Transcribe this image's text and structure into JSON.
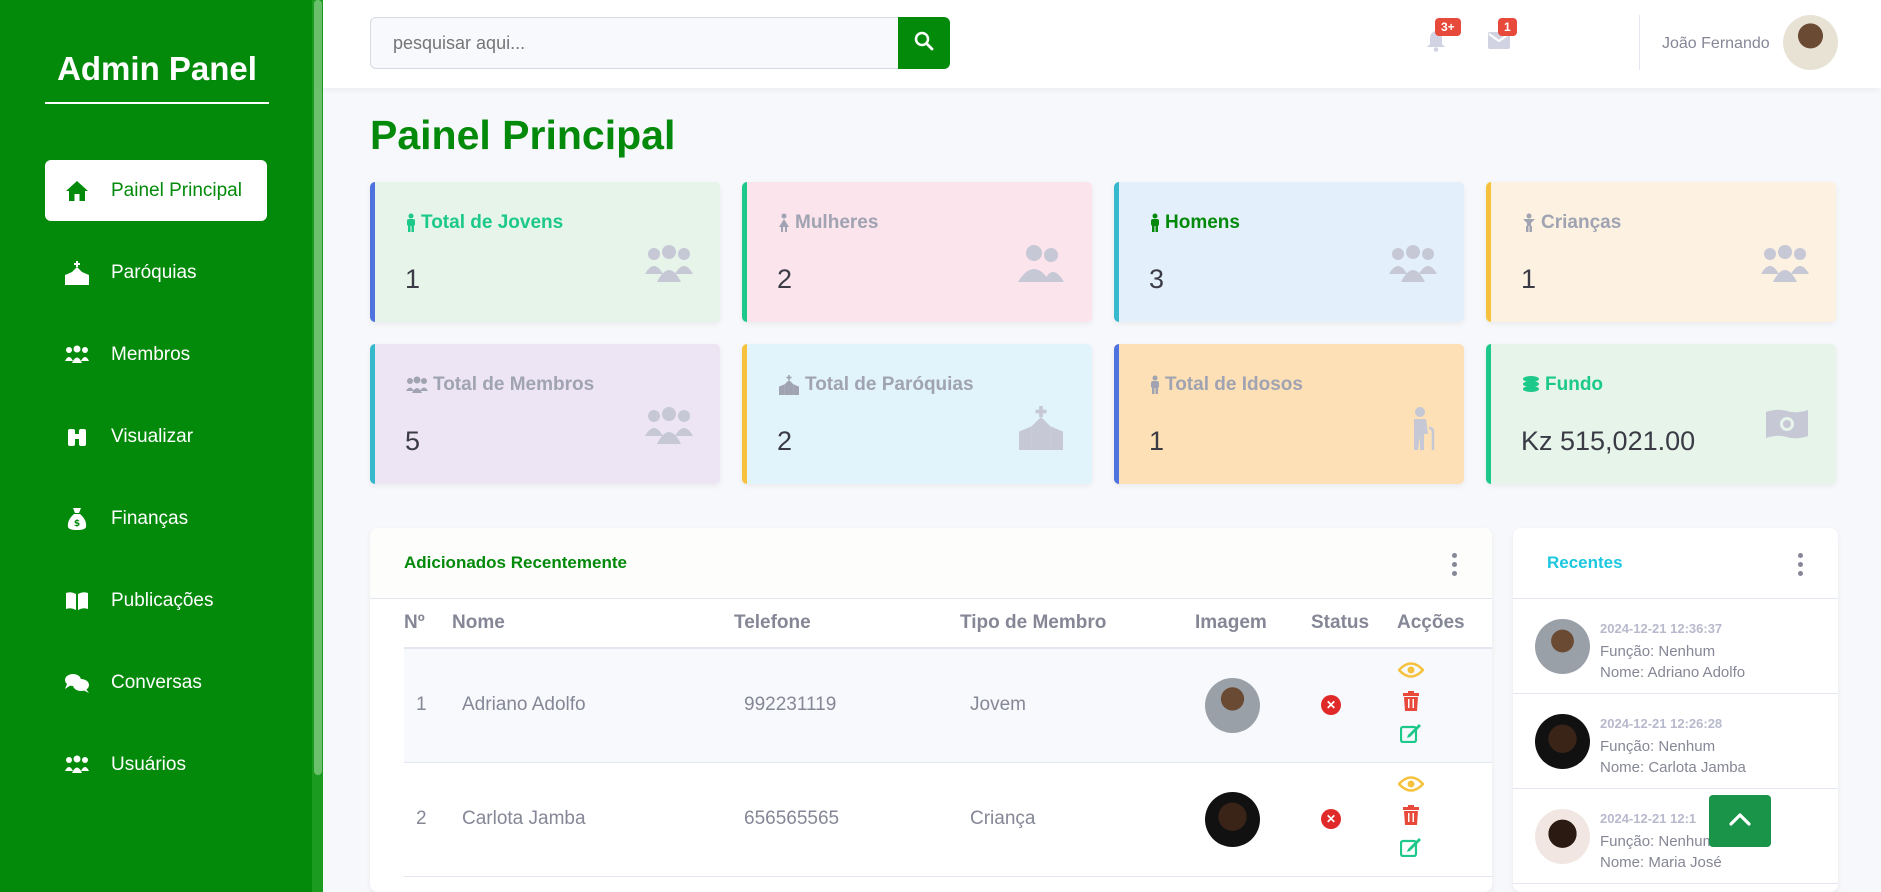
{
  "brand": "Admin Panel",
  "sidebar": {
    "items": [
      {
        "label": "Painel Principal",
        "icon": "home-icon",
        "active": true
      },
      {
        "label": "Paróquias",
        "icon": "church-icon"
      },
      {
        "label": "Membros",
        "icon": "users-icon"
      },
      {
        "label": "Visualizar",
        "icon": "binoculars-icon"
      },
      {
        "label": "Finanças",
        "icon": "money-bag-icon"
      },
      {
        "label": "Publicações",
        "icon": "book-icon"
      },
      {
        "label": "Conversas",
        "icon": "comments-icon"
      },
      {
        "label": "Usuários",
        "icon": "user-group-icon"
      }
    ]
  },
  "topbar": {
    "search_placeholder": "pesquisar aqui...",
    "alerts_count": "3+",
    "messages_count": "1",
    "user_name": "João Fernando"
  },
  "page_title": "Painel Principal",
  "cards": [
    {
      "label": "Total de Jovens",
      "value": "1",
      "accent": "#4e73df",
      "bg": "#e6f4ea",
      "label_color": "#1cc88a"
    },
    {
      "label": "Mulheres",
      "value": "2",
      "accent": "#1cc88a",
      "bg": "#fbe4ec",
      "label_color": "#a0a3b1"
    },
    {
      "label": "Homens",
      "value": "3",
      "accent": "#36b9cc",
      "bg": "#e3f0fb",
      "label_color": "#038a0a"
    },
    {
      "label": "Crianças",
      "value": "1",
      "accent": "#f6c23e",
      "bg": "#fdf1e2",
      "label_color": "#a0a3b1"
    },
    {
      "label": "Total de Membros",
      "value": "5",
      "accent": "#36b9cc",
      "bg": "#ede5f4",
      "label_color": "#a0a3b1"
    },
    {
      "label": "Total de Paróquias",
      "value": "2",
      "accent": "#f6c23e",
      "bg": "#e1f3fb",
      "label_color": "#a0a3b1"
    },
    {
      "label": "Total de Idosos",
      "value": "1",
      "accent": "#4e73df",
      "bg": "#fde0b5",
      "label_color": "#a0a3b1"
    },
    {
      "label": "Fundo",
      "value": "Kz 515,021.00",
      "accent": "#1cc88a",
      "bg": "#e6f4ea",
      "label_color": "#1cc88a"
    }
  ],
  "recent_table": {
    "title": "Adicionados Recentemente",
    "headers": [
      "Nº",
      "Nome",
      "Telefone",
      "Tipo de Membro",
      "Imagem",
      "Status",
      "Acções"
    ],
    "rows": [
      {
        "n": "1",
        "nome": "Adriano Adolfo",
        "telefone": "992231119",
        "tipo": "Jovem"
      },
      {
        "n": "2",
        "nome": "Carlota Jamba",
        "telefone": "656565565",
        "tipo": "Criança"
      }
    ]
  },
  "recentes": {
    "title": "Recentes",
    "items": [
      {
        "date": "2024-12-21 12:36:37",
        "funcao": "Função: Nenhum",
        "nome": "Nome: Adriano Adolfo"
      },
      {
        "date": "2024-12-21 12:26:28",
        "funcao": "Função: Nenhum",
        "nome": "Nome: Carlota Jamba"
      },
      {
        "date": "2024-12-21 12:1",
        "funcao": "Função: Nenhum",
        "nome": "Nome: Maria José"
      }
    ]
  }
}
